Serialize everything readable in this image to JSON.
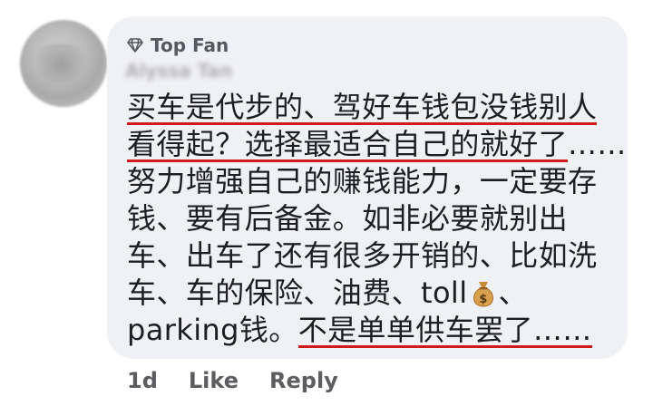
{
  "badge": {
    "label": "Top Fan",
    "icon": "diamond-icon"
  },
  "commenter": {
    "name": "Alyssa Tan"
  },
  "comment": {
    "lines": [
      {
        "underlined": "买车是代步的、驾好车钱包没钱别人"
      },
      {
        "underlined": "看得起？选择最适合自己的就好了",
        "after": "……"
      },
      {
        "text": "努力增强自己的赚钱能力，一定要存"
      },
      {
        "text": "钱、要有后备金。如非必要就别出"
      },
      {
        "text": "车、出车了还有很多开销的、比如洗"
      },
      {
        "before": "车、车的保险、油费、toll",
        "emoji": "money-bag-icon",
        "after": "、"
      },
      {
        "before": "parking钱。",
        "underlined": "不是单单供车罢了……"
      }
    ]
  },
  "actions": {
    "time": "1d",
    "like": "Like",
    "reply": "Reply"
  },
  "colors": {
    "bubble": "#f0f1f5",
    "text": "#1c1e21",
    "underline": "#d11b1b",
    "meta": "#5b5d61"
  }
}
